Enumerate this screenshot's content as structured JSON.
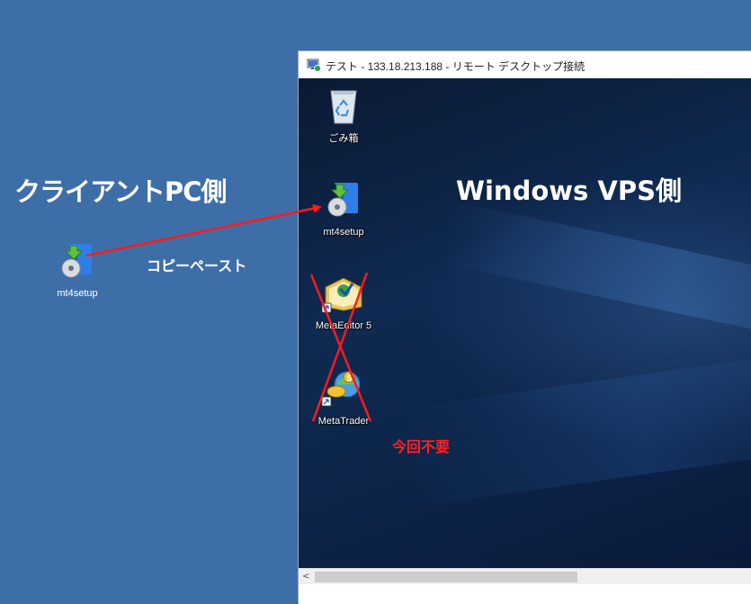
{
  "labels": {
    "client_side": "クライアントPC側",
    "copy_paste": "コピーペースト",
    "vps_side": "Windows VPS側",
    "not_needed": "今回不要"
  },
  "client_desktop": {
    "icon": {
      "name": "mt4setup-icon",
      "label": "mt4setup"
    }
  },
  "rdp_window": {
    "title": "テスト - 133.18.213.188 - リモート デスクトップ接続",
    "desktop_icons": [
      {
        "name": "recycle-bin-icon",
        "label": "ごみ箱"
      },
      {
        "name": "mt4setup-icon",
        "label": "mt4setup"
      },
      {
        "name": "metaeditor-icon",
        "label": "MetaEditor 5"
      },
      {
        "name": "metatrader-icon",
        "label": "MetaTrader"
      }
    ],
    "scrollbar": {
      "arrow": "<"
    }
  },
  "colors": {
    "background": "#3d6ea8",
    "annotation_red": "#ff2020",
    "label_white": "#ffffff"
  }
}
